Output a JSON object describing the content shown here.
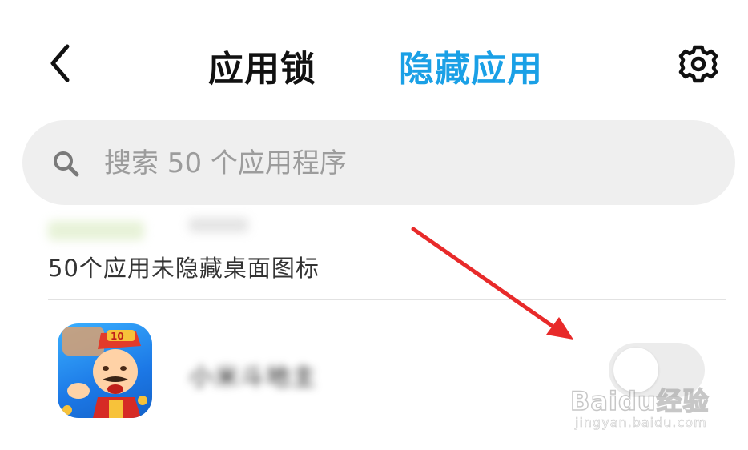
{
  "header": {
    "back_icon": "chevron-left-icon",
    "tab_lock_label": "应用锁",
    "tab_hide_label": "隐藏应用",
    "active_tab": "隐藏应用",
    "settings_icon": "gear-icon",
    "accent_color": "#1aa0e6"
  },
  "search": {
    "icon": "search-icon",
    "placeholder": "搜索 50 个应用程序",
    "value": ""
  },
  "section": {
    "label": "50个应用未隐藏桌面图标"
  },
  "apps": [
    {
      "name": "小米斗地主",
      "icon": "app-game-icon",
      "hidden_toggle": false
    }
  ],
  "annotation": {
    "color": "#e82a2a",
    "type": "red-arrow"
  },
  "watermark": {
    "logo": "Baidu经验",
    "url": "jingyan.baidu.com"
  }
}
